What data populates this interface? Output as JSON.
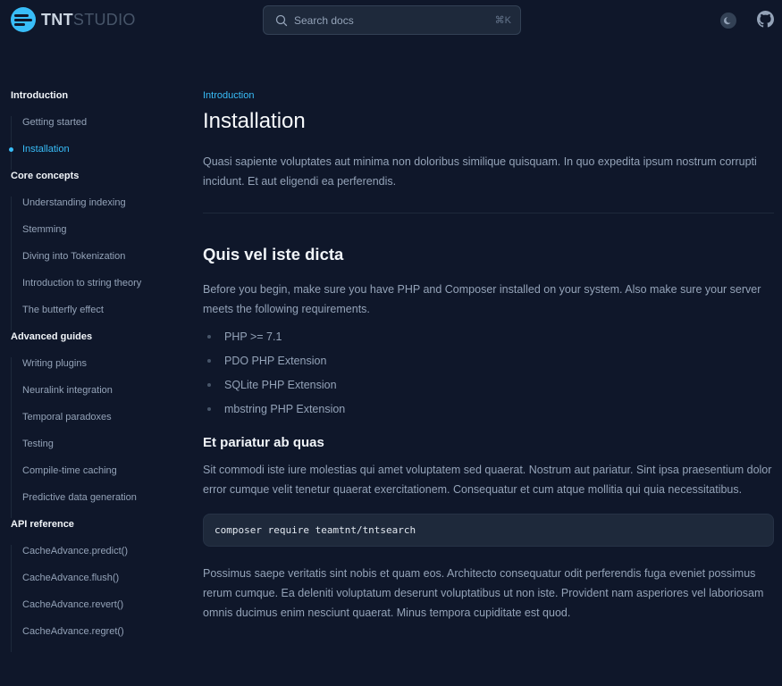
{
  "brand": {
    "name_bold": "TNT",
    "name_light": "STUDIO",
    "logo_color": "#38bdf8"
  },
  "search": {
    "placeholder": "Search docs",
    "shortcut": "⌘K",
    "icon": "search-icon"
  },
  "header_actions": {
    "theme_icon": "moon-icon",
    "github_icon": "github-icon"
  },
  "sidebar": {
    "sections": [
      {
        "title": "Introduction",
        "items": [
          {
            "label": "Getting started",
            "active": false
          },
          {
            "label": "Installation",
            "active": true
          }
        ]
      },
      {
        "title": "Core concepts",
        "items": [
          {
            "label": "Understanding indexing",
            "active": false
          },
          {
            "label": "Stemming",
            "active": false
          },
          {
            "label": "Diving into Tokenization",
            "active": false
          },
          {
            "label": "Introduction to string theory",
            "active": false
          },
          {
            "label": "The butterfly effect",
            "active": false
          }
        ]
      },
      {
        "title": "Advanced guides",
        "items": [
          {
            "label": "Writing plugins",
            "active": false
          },
          {
            "label": "Neuralink integration",
            "active": false
          },
          {
            "label": "Temporal paradoxes",
            "active": false
          },
          {
            "label": "Testing",
            "active": false
          },
          {
            "label": "Compile-time caching",
            "active": false
          },
          {
            "label": "Predictive data generation",
            "active": false
          }
        ]
      },
      {
        "title": "API reference",
        "items": [
          {
            "label": "CacheAdvance.predict()",
            "active": false
          },
          {
            "label": "CacheAdvance.flush()",
            "active": false
          },
          {
            "label": "CacheAdvance.revert()",
            "active": false
          },
          {
            "label": "CacheAdvance.regret()",
            "active": false
          }
        ]
      }
    ]
  },
  "main": {
    "eyebrow": "Introduction",
    "title": "Installation",
    "lead": "Quasi sapiente voluptates aut minima non doloribus similique quisquam. In quo expedita ipsum nostrum corrupti incidunt. Et aut eligendi ea perferendis.",
    "section_heading": "Quis vel iste dicta",
    "paragraph_1": "Before you begin, make sure you have PHP and Composer installed on your system. Also make sure your server meets the following requirements.",
    "requirements": [
      "PHP >= 7.1",
      "PDO PHP Extension",
      "SQLite PHP Extension",
      "mbstring PHP Extension"
    ],
    "subheading": "Et pariatur ab quas",
    "paragraph_2": "Sit commodi iste iure molestias qui amet voluptatem sed quaerat. Nostrum aut pariatur. Sint ipsa praesentium dolor error cumque velit tenetur quaerat exercitationem. Consequatur et cum atque mollitia qui quia necessitatibus.",
    "code": "composer require teamtnt/tntsearch",
    "paragraph_3": "Possimus saepe veritatis sint nobis et quam eos. Architecto consequatur odit perferendis fuga eveniet possimus rerum cumque. Ea deleniti voluptatum deserunt voluptatibus ut non iste. Provident nam asperiores vel laboriosam omnis ducimus enim nesciunt quaerat. Minus tempora cupiditate est quod."
  }
}
